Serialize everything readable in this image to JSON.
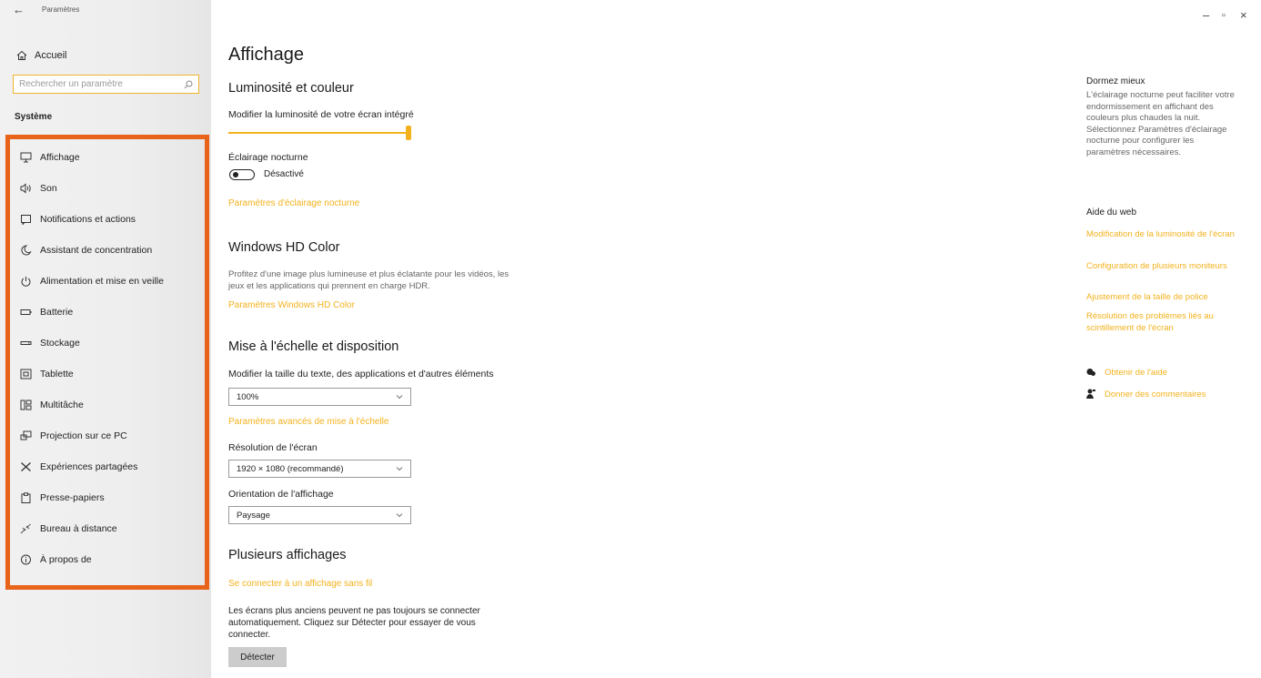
{
  "window": {
    "title": "Paramètres",
    "controls": {
      "minimize": "–",
      "maximize": "▫",
      "close": "×"
    }
  },
  "sidebar": {
    "home_label": "Accueil",
    "search_placeholder": "Rechercher un paramètre",
    "section_label": "Système",
    "items": [
      {
        "label": "Affichage",
        "icon": "monitor-icon"
      },
      {
        "label": "Son",
        "icon": "speaker-icon"
      },
      {
        "label": "Notifications et actions",
        "icon": "notification-icon"
      },
      {
        "label": "Assistant de concentration",
        "icon": "moon-icon"
      },
      {
        "label": "Alimentation et mise en veille",
        "icon": "power-icon"
      },
      {
        "label": "Batterie",
        "icon": "battery-icon"
      },
      {
        "label": "Stockage",
        "icon": "storage-icon"
      },
      {
        "label": "Tablette",
        "icon": "tablet-icon"
      },
      {
        "label": "Multitâche",
        "icon": "multitask-icon"
      },
      {
        "label": "Projection sur ce PC",
        "icon": "projection-icon"
      },
      {
        "label": "Expériences partagées",
        "icon": "shared-icon"
      },
      {
        "label": "Presse-papiers",
        "icon": "clipboard-icon"
      },
      {
        "label": "Bureau à distance",
        "icon": "remote-icon"
      },
      {
        "label": "À propos de",
        "icon": "info-icon"
      }
    ],
    "highlight_color": "#e8641b"
  },
  "main": {
    "title": "Affichage",
    "brightness": {
      "heading": "Luminosité et couleur",
      "slider_label": "Modifier la luminosité de votre écran intégré",
      "slider_value_percent": 100,
      "night_light_label": "Éclairage nocturne",
      "night_light_state": "Désactivé",
      "night_light_link": "Paramètres d'éclairage nocturne"
    },
    "hdr": {
      "heading": "Windows HD Color",
      "description": "Profitez d'une image plus lumineuse et plus éclatante pour les vidéos, les jeux et les applications qui prennent en charge HDR.",
      "link": "Paramètres Windows HD Color"
    },
    "scale": {
      "heading": "Mise à l'échelle et disposition",
      "size_label": "Modifier la taille du texte, des applications et d'autres éléments",
      "size_value": "100%",
      "advanced_link": "Paramètres avancés de mise à l'échelle",
      "resolution_label": "Résolution de l'écran",
      "resolution_value": "1920 × 1080 (recommandé)",
      "orientation_label": "Orientation de l'affichage",
      "orientation_value": "Paysage"
    },
    "multi": {
      "heading": "Plusieurs affichages",
      "wireless_link": "Se connecter à un affichage sans fil",
      "description": "Les écrans plus anciens peuvent ne pas toujours se connecter automatiquement. Cliquez sur Détecter pour essayer de vous connecter.",
      "detect_button": "Détecter"
    }
  },
  "right": {
    "sleep_heading": "Dormez mieux",
    "sleep_text": "L'éclairage nocturne peut faciliter votre endormissement en affichant des couleurs plus chaudes la nuit. Sélectionnez Paramètres d'éclairage nocturne pour configurer les paramètres nécessaires.",
    "web_heading": "Aide du web",
    "web_links": [
      "Modification de la luminosité de l'écran",
      "Configuration de plusieurs moniteurs",
      "Ajustement de la taille de police",
      "Résolution des problèmes liés au scintillement de l'écran"
    ],
    "get_help": "Obtenir de l'aide",
    "feedback": "Donner des commentaires"
  },
  "colors": {
    "accent": "#f3b21d",
    "highlight": "#e8641b"
  }
}
